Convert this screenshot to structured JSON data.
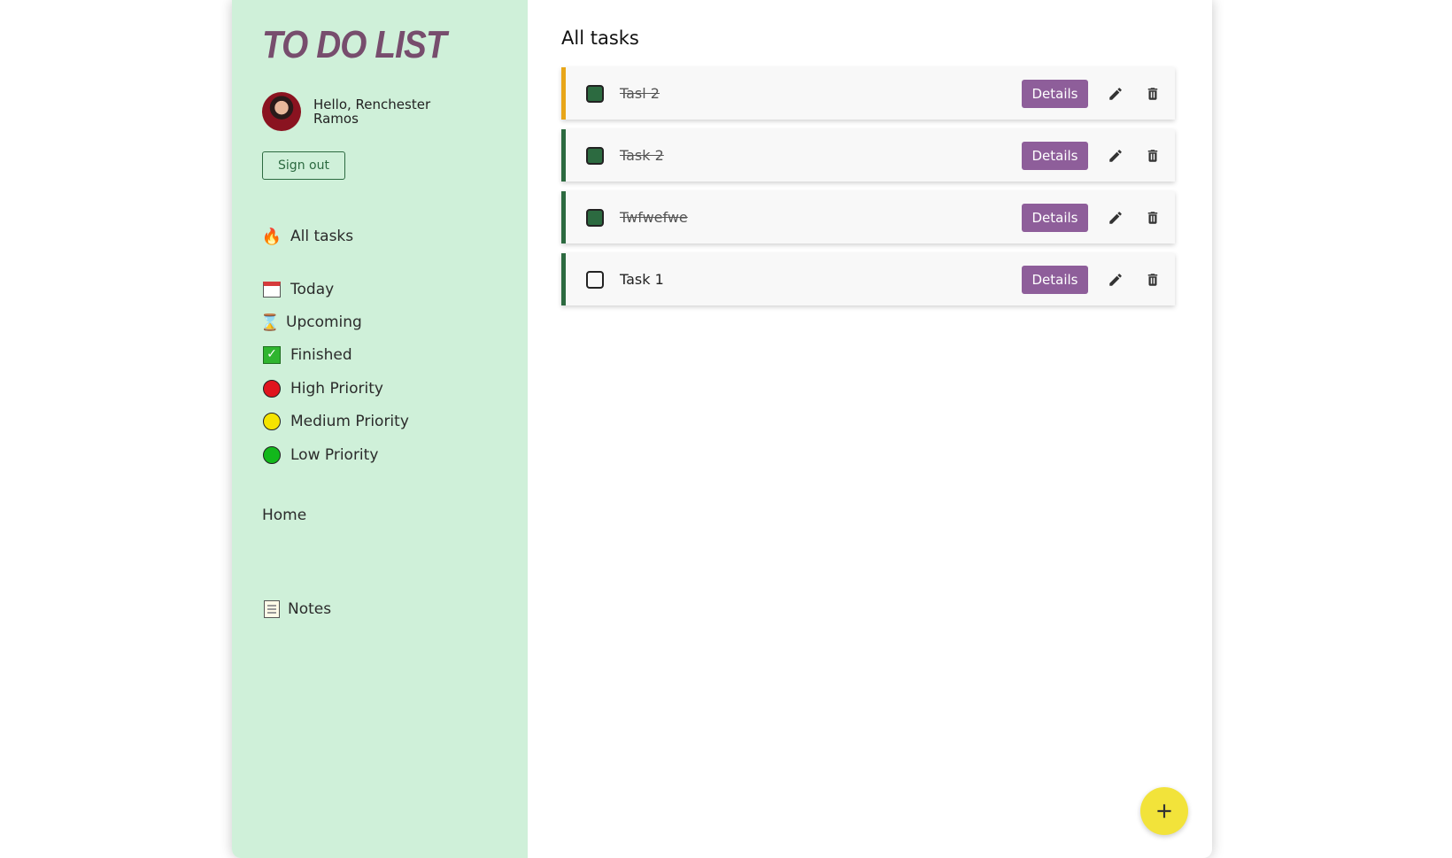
{
  "sidebar": {
    "logo": "TO DO LIST",
    "greeting": "Hello, Renchester Ramos",
    "signout_label": "Sign out",
    "nav": [
      {
        "label": "All tasks",
        "icon": "flame-icon"
      },
      {
        "label": "Today",
        "icon": "calendar-icon"
      },
      {
        "label": "Upcoming",
        "icon": "hourglass-icon"
      },
      {
        "label": "Finished",
        "icon": "checkmark-icon"
      },
      {
        "label": "High Priority",
        "icon": "red-dot-icon",
        "color": "#e0141e"
      },
      {
        "label": "Medium Priority",
        "icon": "yellow-dot-icon",
        "color": "#f5e400"
      },
      {
        "label": "Low Priority",
        "icon": "green-dot-icon",
        "color": "#12b81b"
      }
    ],
    "home_label": "Home",
    "notes_label": "Notes"
  },
  "main": {
    "title": "All tasks",
    "details_label": "Details",
    "tasks": [
      {
        "name": "Tasl 2",
        "done": true,
        "accent": "#e8a619"
      },
      {
        "name": "Task 2",
        "done": true,
        "accent": "#2c6a40"
      },
      {
        "name": "Twfwefwe",
        "done": true,
        "accent": "#2c6a40"
      },
      {
        "name": "Task 1",
        "done": false,
        "accent": "#2c6a40"
      }
    ]
  },
  "colors": {
    "sidebar_bg": "#cff0d9",
    "logo": "#774d6d",
    "details_btn": "#8e5e9a",
    "fab": "#f2e33a"
  }
}
